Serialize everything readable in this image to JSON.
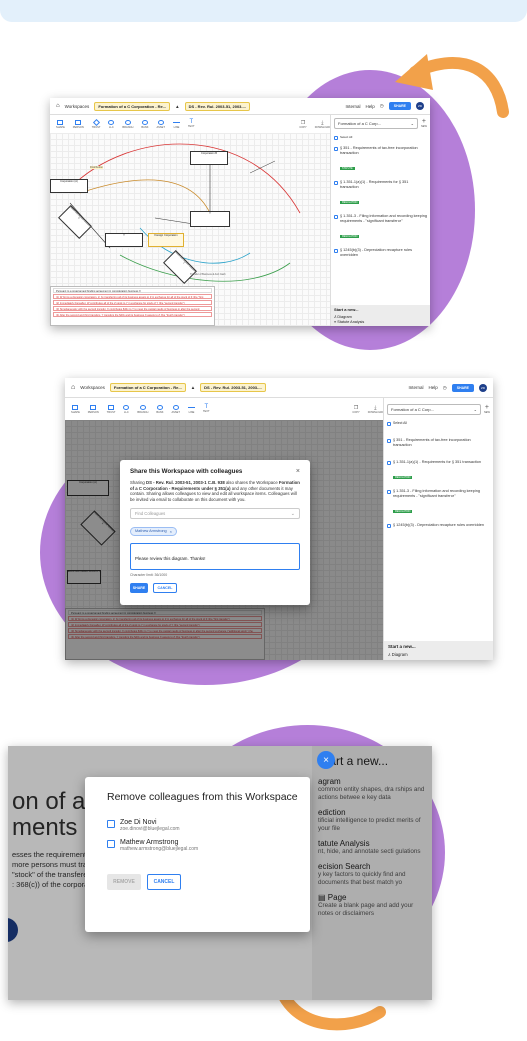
{
  "colors": {
    "accent": "#2f7ff0",
    "blob": "#b57fd9",
    "arrow": "#f2a14a",
    "badge": "#2e9e4b",
    "crumb": "#fcf3cf"
  },
  "app": {
    "home_icon": "home-icon",
    "workspaces": "Workspaces",
    "crumb_workspace": "Formation of a C Corporation - Re...",
    "crumb_doc": "DS - Rev. Rul. 2003-51, 2003-...",
    "internal": "Internal",
    "help": "Help",
    "share": "SHARE",
    "avatar": "ZD",
    "tools": [
      "SHAPE",
      "PERSON",
      "TRUST",
      "LLC",
      "BRANCH",
      "BANK",
      "ASSET",
      "LINE",
      "TEXT"
    ],
    "copy": "COPY",
    "download": "DOWNLOAD",
    "panel_dropdown": "Formation of a C Corp...",
    "new_label": "NEW",
    "select_all": "Select All",
    "docs": [
      {
        "title": "§ 351 - Requirements of tax-free incorporation transaction",
        "badge": "STATUTE"
      },
      {
        "title": "§ 1.351-1(a)(1) - Requirements for § 351 transaction",
        "badge": "REGULATION"
      },
      {
        "title": "§ 1.351-3 - Filing information and recording keeping requirements - \"significant transferor\"",
        "badge": "REGULATION"
      },
      {
        "title": "§ 1245(b)(3) - Depreciation recapture rules overridden",
        "badge": ""
      }
    ],
    "start_new": "Start a new...",
    "diagram": "Diagram",
    "statute_analysis": "Statute Analysis",
    "diagram_nodes": {
      "a": "Corporation (A)",
      "b": "Corporation B",
      "y": "Y",
      "c": "Y",
      "fx": "Foreign Corporation",
      "sub": "Assets and Liabilities Business A",
      "bx": "Assets and Liabilities Business X"
    },
    "diagram_labels": {
      "dist": "Distribution",
      "transfer": "Transfer of Business & Acct Cash"
    },
    "notes": [
      "Pursuant to a prearranged binding agreement in consideration business X",
      "(1) W forms a domestic corporation, Z, by transferring all of its business assets to Z in exchange for all of the stock of Z (the \"first transfer\")",
      "(2) Immediately thereafter, W contributes all of the Z stock to Y in exchange for stock of Y (the \"second transfer\")",
      "(3) Simultaneously with the second transfer, X contributes $40x to Y to meet the capital needs of business in after the second exchange (\"additional stock\" (the \"third transfer\"))",
      "(4) After the second and third transfers, Y transfers the $40x and its business X assets to Z (the \"fourth transfer\")"
    ]
  },
  "share_modal": {
    "title": "Share this Workspace with colleagues",
    "body_prefix": "Sharing ",
    "body_doc": "DS - Rev. Rul. 2003-51, 2003-1 C.B. 938",
    "body_mid": " also shares the Workspace ",
    "body_ws": "Formation of a C Corporation - Requirements under § 351(a)",
    "body_suffix": " and any other documents it may contain. Sharing allows colleagues to view and edit all workspace items. Colleagues will be invited via email to collaborate on this document with you.",
    "find_placeholder": "Find Colleagues",
    "chip": "Mathew Armstrong",
    "message": "Please review this diagram. Thanks!",
    "char_limit": "Character limit: 36/1000",
    "share_btn": "SHARE",
    "cancel_btn": "CANCEL",
    "close_icon": "close-icon"
  },
  "remove_modal": {
    "title": "Remove colleagues from this Workspace",
    "people": [
      {
        "name": "Zoe Di Novi",
        "email": "zoe.dinovi@bluejlegal.com"
      },
      {
        "name": "Mathew Armstrong",
        "email": "mathew.armstrong@bluejlegal.com"
      }
    ],
    "remove_btn": "REMOVE",
    "cancel_btn": "CANCEL"
  },
  "bg3": {
    "heading_line1": "on of a C",
    "heading_line2": "ments un",
    "para1": "esses the requirements fo",
    "para2": "more persons must transfe",
    "para3": "\"stock\" of the transferee",
    "para4": ": 368(c)) of the corporat",
    "start_new": "Start a new...",
    "items": [
      {
        "title": "agram",
        "desc": "common entity shapes, dra rships and actions betwee e key data"
      },
      {
        "title": "ediction",
        "desc": "tificial intelligence to predict merits of your file"
      },
      {
        "title": "tatute Analysis",
        "desc": "nt, hide, and annotate secti gulations"
      },
      {
        "title": "ecision Search",
        "desc": "y key factors to quickly find and documents that best match yo"
      },
      {
        "title": "Page",
        "desc": "Create a blank page and add your notes or disclaimers"
      }
    ]
  }
}
